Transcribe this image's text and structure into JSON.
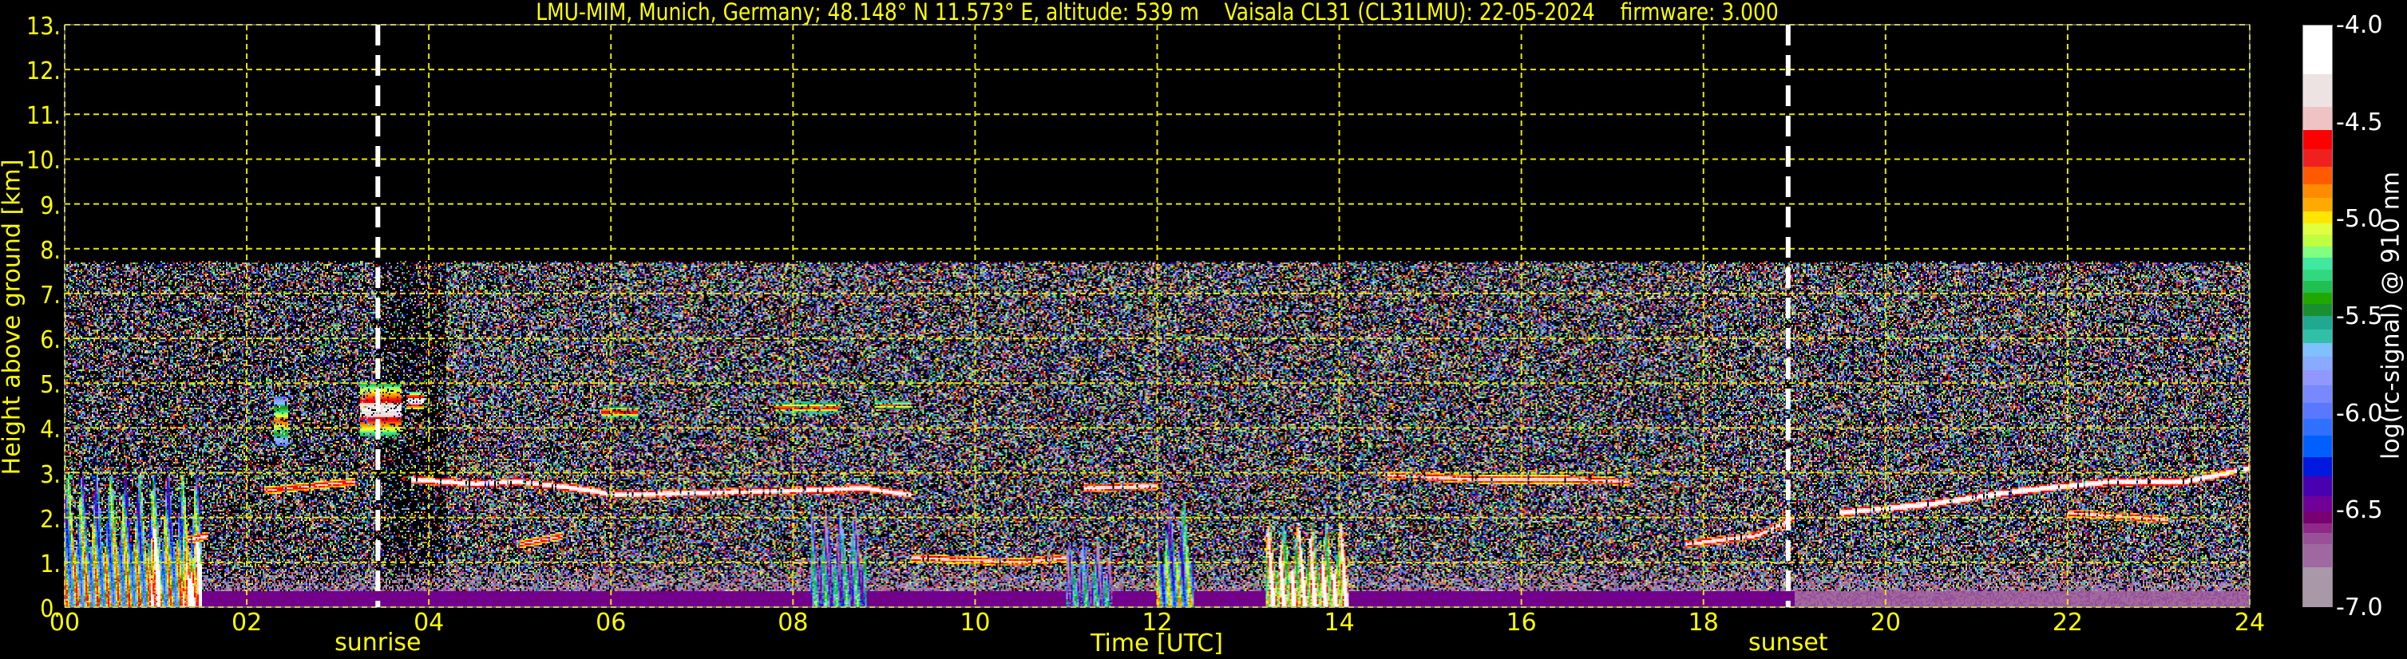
{
  "chart_data": {
    "type": "heatmap",
    "title": "LMU-MIM, Munich, Germany; 48.148° N 11.573° E, altitude: 539 m    Vaisala CL31 (CL31LMU): 22-05-2024    firmware: 3.000",
    "xlabel": "Time [UTC]",
    "ylabel": "Height above ground [km]",
    "xlim": [
      0,
      24
    ],
    "ylim": [
      0,
      13
    ],
    "grid": true,
    "xticks": [
      0,
      2,
      4,
      6,
      8,
      10,
      12,
      14,
      16,
      18,
      20,
      22,
      24
    ],
    "xtick_labels": [
      "00",
      "02",
      "04",
      "06",
      "08",
      "10",
      "12",
      "14",
      "16",
      "18",
      "20",
      "22",
      "24"
    ],
    "yticks": [
      0,
      1,
      2,
      3,
      4,
      5,
      6,
      7,
      8,
      9,
      10,
      11,
      12,
      13
    ],
    "ytick_labels": [
      "0.",
      "1.",
      "2.",
      "3.",
      "4.",
      "5.",
      "6.",
      "7.",
      "8.",
      "9.",
      "10.",
      "11.",
      "12.",
      "13."
    ],
    "events": [
      {
        "label": "sunrise",
        "time": 3.44
      },
      {
        "label": "sunset",
        "time": 18.93
      }
    ],
    "colorbar": {
      "label": "log(rc-signal) @ 910 nm",
      "range": [
        -7.0,
        -4.0
      ],
      "ticks": [
        -4.0,
        -4.5,
        -5.0,
        -5.5,
        -6.0,
        -6.5,
        -7.0
      ],
      "tick_labels": [
        "-4.0",
        "-4.5",
        "-5.0",
        "-5.5",
        "-6.0",
        "-6.5",
        "-7.0"
      ],
      "levels": [
        -4.0,
        -4.25,
        -4.42,
        -4.54,
        -4.64,
        -4.73,
        -4.82,
        -4.89,
        -4.96,
        -5.02,
        -5.08,
        -5.14,
        -5.2,
        -5.26,
        -5.32,
        -5.38,
        -5.44,
        -5.5,
        -5.57,
        -5.64,
        -5.71,
        -5.78,
        -5.86,
        -5.95,
        -6.03,
        -6.12,
        -6.23,
        -6.33,
        -6.43,
        -6.51,
        -6.57,
        -6.62,
        -6.68,
        -6.8,
        -7.0
      ],
      "colors": [
        "#ffffff",
        "#ede3e3",
        "#efc3c3",
        "#ff0000",
        "#f02020",
        "#ff5a00",
        "#ff8c00",
        "#ffaa00",
        "#ffe600",
        "#e0ff40",
        "#c0ff40",
        "#80ff80",
        "#40e8a0",
        "#30d880",
        "#20c050",
        "#20a800",
        "#189030",
        "#20a890",
        "#30c0a8",
        "#80c0ff",
        "#88aaff",
        "#9098ff",
        "#7888ff",
        "#5878ff",
        "#3070ff",
        "#0060ff",
        "#0018e0",
        "#4800b0",
        "#700098",
        "#780070",
        "#902888",
        "#985098",
        "#a068a0",
        "#a898a8"
      ]
    },
    "signal_top_km": 7.7,
    "cloud_layers": [
      {
        "name": "boundary-layer-top-morning",
        "value": -4.1,
        "points": [
          [
            3.8,
            2.85
          ],
          [
            4.5,
            2.75
          ],
          [
            5.0,
            2.8
          ],
          [
            5.8,
            2.6
          ],
          [
            6.0,
            2.5
          ],
          [
            7.0,
            2.55
          ],
          [
            8.0,
            2.6
          ],
          [
            8.8,
            2.65
          ],
          [
            9.3,
            2.5
          ]
        ]
      },
      {
        "name": "boundary-layer-top-noon",
        "value": -4.2,
        "points": [
          [
            11.2,
            2.65
          ],
          [
            12.0,
            2.7
          ]
        ]
      },
      {
        "name": "boundary-layer-top-afternoon",
        "value": -4.3,
        "points": [
          [
            14.5,
            2.95
          ],
          [
            15.5,
            2.85
          ],
          [
            16.5,
            2.85
          ],
          [
            17.2,
            2.8
          ]
        ]
      },
      {
        "name": "boundary-layer-top-evening",
        "value": -4.05,
        "points": [
          [
            19.5,
            2.1
          ],
          [
            20.5,
            2.3
          ],
          [
            21.5,
            2.6
          ],
          [
            22.5,
            2.8
          ],
          [
            23.3,
            2.8
          ],
          [
            24.0,
            3.1
          ]
        ]
      },
      {
        "name": "low-cloud-night",
        "value": -4.3,
        "points": [
          [
            1.35,
            1.5
          ],
          [
            1.6,
            1.6
          ]
        ]
      },
      {
        "name": "residual-layer-night",
        "value": -4.4,
        "points": [
          [
            2.2,
            2.6
          ],
          [
            3.2,
            2.8
          ]
        ]
      },
      {
        "name": "low-cloud-05h",
        "value": -4.4,
        "points": [
          [
            5.0,
            1.4
          ],
          [
            5.5,
            1.6
          ]
        ]
      },
      {
        "name": "low-cloud-10h",
        "value": -4.3,
        "points": [
          [
            9.3,
            1.1
          ],
          [
            10.5,
            1.0
          ],
          [
            11.0,
            1.1
          ]
        ]
      },
      {
        "name": "low-cloud-18h",
        "value": -4.2,
        "points": [
          [
            17.8,
            1.4
          ],
          [
            18.6,
            1.6
          ],
          [
            19.0,
            2.0
          ]
        ]
      },
      {
        "name": "low-cloud-22h",
        "value": -4.3,
        "points": [
          [
            22.0,
            2.1
          ],
          [
            23.1,
            1.95
          ]
        ]
      }
    ],
    "mid_clouds": [
      {
        "t": [
          2.3,
          2.45
        ],
        "h": [
          3.6,
          4.7
        ],
        "value": -4.8
      },
      {
        "t": [
          3.25,
          3.7
        ],
        "h": [
          3.8,
          5.0
        ],
        "value": -4.2
      },
      {
        "t": [
          3.75,
          3.95
        ],
        "h": [
          4.4,
          4.8
        ],
        "value": -4.1
      },
      {
        "t": [
          5.9,
          6.3
        ],
        "h": [
          4.2,
          4.5
        ],
        "value": -4.5
      },
      {
        "t": [
          7.8,
          8.5
        ],
        "h": [
          4.3,
          4.6
        ],
        "value": -4.6
      },
      {
        "t": [
          8.9,
          9.3
        ],
        "h": [
          4.4,
          4.6
        ],
        "value": -4.7
      }
    ],
    "precipitation": [
      {
        "t": [
          0.0,
          1.5
        ],
        "top": 3.0,
        "value": -5.3
      },
      {
        "t": [
          0.95,
          1.05
        ],
        "top": 1.8,
        "value": -4.0
      },
      {
        "t": [
          1.3,
          1.5
        ],
        "top": 1.6,
        "value": -4.1
      },
      {
        "t": [
          8.2,
          8.8
        ],
        "top": 2.2,
        "value": -5.8
      },
      {
        "t": [
          11.0,
          11.5
        ],
        "top": 1.5,
        "value": -5.9
      },
      {
        "t": [
          12.0,
          12.4
        ],
        "top": 2.4,
        "value": -5.5
      },
      {
        "t": [
          13.2,
          14.1
        ],
        "top": 1.9,
        "value": -4.5
      }
    ]
  }
}
